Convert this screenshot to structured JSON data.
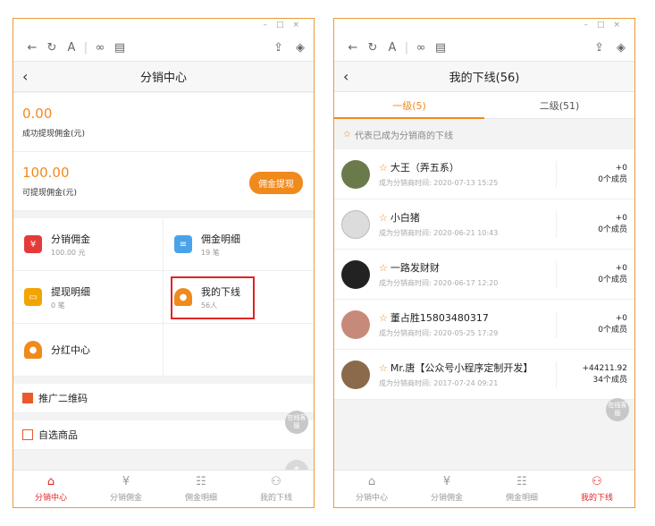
{
  "left": {
    "title": "分销中心",
    "balance1": {
      "amount": "0.00",
      "label": "成功提现佣金(元)"
    },
    "balance2": {
      "amount": "100.00",
      "label": "可提现佣金(元)",
      "button": "佣金提现"
    },
    "grid": [
      {
        "title": "分销佣金",
        "sub": "100.00 元",
        "color": "#e53a3a"
      },
      {
        "title": "佣金明细",
        "sub": "19 笔",
        "color": "#4aa3e8"
      },
      {
        "title": "提现明细",
        "sub": "0 笔",
        "color": "#f2a400"
      },
      {
        "title": "我的下线",
        "sub": "56人",
        "color": "#f08a1c"
      },
      {
        "title": "分红中心",
        "sub": "",
        "color": "#f08a1c"
      }
    ],
    "rows": [
      "推广二维码",
      "自选商品"
    ],
    "float_label": "在线客服"
  },
  "right": {
    "title": "我的下线(56)",
    "tabs": [
      "一级(5)",
      "二级(51)"
    ],
    "tip": "代表已成为分销商的下线",
    "members": [
      {
        "name": "大王（弄五系）",
        "time": "成为分销商时间: 2020-07-13 15:25",
        "amount": "+0",
        "count": "0个成员",
        "avatar_color": "#6b7a4a"
      },
      {
        "name": "小白猪",
        "time": "成为分销商时间: 2020-06-21 10:43",
        "amount": "+0",
        "count": "0个成员",
        "avatar_color": "#dcdcdc"
      },
      {
        "name": "一路发财财",
        "time": "成为分销商时间: 2020-06-17 12:20",
        "amount": "+0",
        "count": "0个成员",
        "avatar_color": "#222222"
      },
      {
        "name": "董占胜15803480317",
        "time": "成为分销商时间: 2020-05-25 17:29",
        "amount": "+0",
        "count": "0个成员",
        "avatar_color": "#c78a7a"
      },
      {
        "name": "Mr.唐【公众号小程序定制开发】",
        "time": "成为分销商时间: 2017-07-24 09:21",
        "amount": "+44211.92",
        "count": "34个成员",
        "avatar_color": "#8a6a4a"
      }
    ],
    "float_label": "在线客服"
  },
  "tabbar": [
    "分销中心",
    "分销佣金",
    "佣金明细",
    "我的下线"
  ],
  "accent": "#f08a1c"
}
